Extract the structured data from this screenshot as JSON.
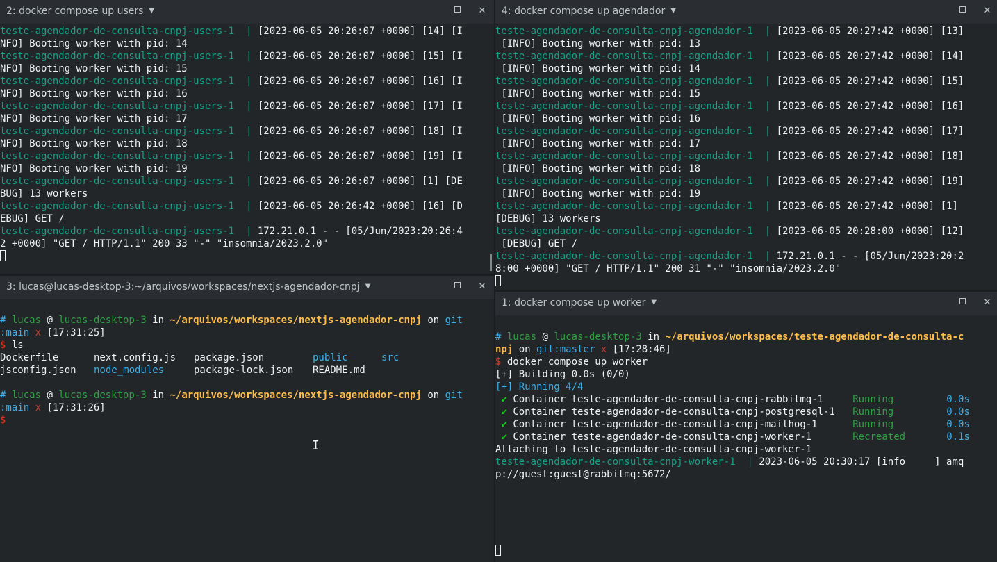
{
  "pane_users": {
    "title": "2: docker compose up users",
    "lines": [
      {
        "prefix": "teste-agendador-de-consulta-cnpj-users-1  | ",
        "text": "[2023-06-05 20:26:07 +0000] [14] [I"
      },
      {
        "prefix": "",
        "text": "NFO] Booting worker with pid: 14"
      },
      {
        "prefix": "teste-agendador-de-consulta-cnpj-users-1  | ",
        "text": "[2023-06-05 20:26:07 +0000] [15] [I"
      },
      {
        "prefix": "",
        "text": "NFO] Booting worker with pid: 15"
      },
      {
        "prefix": "teste-agendador-de-consulta-cnpj-users-1  | ",
        "text": "[2023-06-05 20:26:07 +0000] [16] [I"
      },
      {
        "prefix": "",
        "text": "NFO] Booting worker with pid: 16"
      },
      {
        "prefix": "teste-agendador-de-consulta-cnpj-users-1  | ",
        "text": "[2023-06-05 20:26:07 +0000] [17] [I"
      },
      {
        "prefix": "",
        "text": "NFO] Booting worker with pid: 17"
      },
      {
        "prefix": "teste-agendador-de-consulta-cnpj-users-1  | ",
        "text": "[2023-06-05 20:26:07 +0000] [18] [I"
      },
      {
        "prefix": "",
        "text": "NFO] Booting worker with pid: 18"
      },
      {
        "prefix": "teste-agendador-de-consulta-cnpj-users-1  | ",
        "text": "[2023-06-05 20:26:07 +0000] [19] [I"
      },
      {
        "prefix": "",
        "text": "NFO] Booting worker with pid: 19"
      },
      {
        "prefix": "teste-agendador-de-consulta-cnpj-users-1  | ",
        "text": "[2023-06-05 20:26:07 +0000] [1] [DE"
      },
      {
        "prefix": "",
        "text": "BUG] 13 workers"
      },
      {
        "prefix": "teste-agendador-de-consulta-cnpj-users-1  | ",
        "text": "[2023-06-05 20:26:42 +0000] [16] [D"
      },
      {
        "prefix": "",
        "text": "EBUG] GET /"
      },
      {
        "prefix": "teste-agendador-de-consulta-cnpj-users-1  | ",
        "text": "172.21.0.1 - - [05/Jun/2023:20:26:4"
      },
      {
        "prefix": "",
        "text": "2 +0000] \"GET / HTTP/1.1\" 200 33 \"-\" \"insomnia/2023.2.0\""
      }
    ]
  },
  "pane_agendador": {
    "title": "4: docker compose up agendador",
    "lines": [
      {
        "prefix": "teste-agendador-de-consulta-cnpj-agendador-1  | ",
        "text": "[2023-06-05 20:27:42 +0000] [13]"
      },
      {
        "prefix": "",
        "text": " [INFO] Booting worker with pid: 13"
      },
      {
        "prefix": "teste-agendador-de-consulta-cnpj-agendador-1  | ",
        "text": "[2023-06-05 20:27:42 +0000] [14]"
      },
      {
        "prefix": "",
        "text": " [INFO] Booting worker with pid: 14"
      },
      {
        "prefix": "teste-agendador-de-consulta-cnpj-agendador-1  | ",
        "text": "[2023-06-05 20:27:42 +0000] [15]"
      },
      {
        "prefix": "",
        "text": " [INFO] Booting worker with pid: 15"
      },
      {
        "prefix": "teste-agendador-de-consulta-cnpj-agendador-1  | ",
        "text": "[2023-06-05 20:27:42 +0000] [16]"
      },
      {
        "prefix": "",
        "text": " [INFO] Booting worker with pid: 16"
      },
      {
        "prefix": "teste-agendador-de-consulta-cnpj-agendador-1  | ",
        "text": "[2023-06-05 20:27:42 +0000] [17]"
      },
      {
        "prefix": "",
        "text": " [INFO] Booting worker with pid: 17"
      },
      {
        "prefix": "teste-agendador-de-consulta-cnpj-agendador-1  | ",
        "text": "[2023-06-05 20:27:42 +0000] [18]"
      },
      {
        "prefix": "",
        "text": " [INFO] Booting worker with pid: 18"
      },
      {
        "prefix": "teste-agendador-de-consulta-cnpj-agendador-1  | ",
        "text": "[2023-06-05 20:27:42 +0000] [19]"
      },
      {
        "prefix": "",
        "text": " [INFO] Booting worker with pid: 19"
      },
      {
        "prefix": "teste-agendador-de-consulta-cnpj-agendador-1  | ",
        "text": "[2023-06-05 20:27:42 +0000] [1]"
      },
      {
        "prefix": "",
        "text": "[DEBUG] 13 workers"
      },
      {
        "prefix": "teste-agendador-de-consulta-cnpj-agendador-1  | ",
        "text": "[2023-06-05 20:28:00 +0000] [12]"
      },
      {
        "prefix": "",
        "text": " [DEBUG] GET /"
      },
      {
        "prefix": "teste-agendador-de-consulta-cnpj-agendador-1  | ",
        "text": "172.21.0.1 - - [05/Jun/2023:20:2"
      },
      {
        "prefix": "",
        "text": "8:00 +0000] \"GET / HTTP/1.1\" 200 31 \"-\" \"insomnia/2023.2.0\""
      }
    ]
  },
  "pane_shell": {
    "title": "3: lucas@lucas-desktop-3:~/arquivos/workspaces/nextjs-agendador-cnpj",
    "prompt1": {
      "hash": "# ",
      "user": "lucas",
      "at": " @ ",
      "host": "lucas-desktop-3",
      "in": " in ",
      "path": "~/arquivos/workspaces/nextjs-agendador-cnpj",
      "on": " on ",
      "git": "git",
      "branch": ":main",
      "dirty": " x ",
      "time": "[17:31:25]"
    },
    "cmd1": "ls",
    "ls_row1": [
      "Dockerfile",
      "next.config.js",
      "package.json",
      "public",
      "src"
    ],
    "ls_row2": [
      "jsconfig.json",
      "node_modules",
      "package-lock.json",
      "README.md"
    ],
    "prompt2_time": "[17:31:26]",
    "dollar": "$"
  },
  "pane_worker": {
    "title": "1: docker compose up worker",
    "prompt": {
      "hash": "# ",
      "user": "lucas",
      "at": " @ ",
      "host": "lucas-desktop-3",
      "in": " in ",
      "path": "~/arquivos/workspaces/teste-agendador-de-consulta-c",
      "path2": "npj",
      "on": " on ",
      "git": "git:master",
      "dirty": " x ",
      "time": "[17:28:46]"
    },
    "cmd": "docker compose up worker",
    "building": "[+] Building 0.0s (0/0)",
    "running": "[+] Running 4/4",
    "containers": [
      {
        "check": "✔",
        "label": "Container teste-agendador-de-consulta-cnpj-rabbitmq-1  ",
        "status": "Running  ",
        "time": "0.0s"
      },
      {
        "check": "✔",
        "label": "Container teste-agendador-de-consulta-cnpj-postgresql-1",
        "status": "Running  ",
        "time": "0.0s"
      },
      {
        "check": "✔",
        "label": "Container teste-agendador-de-consulta-cnpj-mailhog-1   ",
        "status": "Running  ",
        "time": "0.0s"
      },
      {
        "check": "✔",
        "label": "Container teste-agendador-de-consulta-cnpj-worker-1    ",
        "status": "Recreated",
        "time": "0.1s"
      }
    ],
    "attaching": "Attaching to teste-agendador-de-consulta-cnpj-worker-1",
    "log_prefix": "teste-agendador-de-consulta-cnpj-worker-1  | ",
    "log_text": "2023-06-05 20:30:17 [info     ] amq",
    "log_text2": "p://guest:guest@rabbitmq:5672/"
  }
}
